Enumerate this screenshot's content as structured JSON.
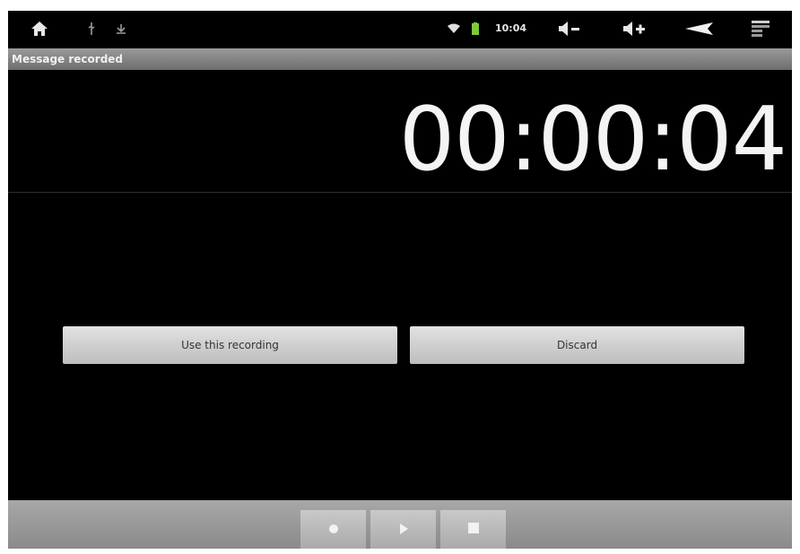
{
  "status_bar": {
    "clock": "10:04",
    "icons": [
      "home-icon",
      "usb-icon",
      "download-icon",
      "wifi-icon",
      "battery-icon",
      "volume-down-icon",
      "volume-up-icon",
      "back-icon",
      "menu-icon"
    ]
  },
  "title_bar": {
    "title": "Message recorded"
  },
  "recorder": {
    "elapsed_time": "00:00:04"
  },
  "actions": {
    "use_label": "Use this recording",
    "discard_label": "Discard"
  },
  "controls": {
    "icons": [
      "record-icon",
      "play-icon",
      "stop-icon"
    ]
  },
  "colors": {
    "background": "#000000",
    "title_bar": "#7f7f7f",
    "button": "#d0d0d0",
    "bottom_bar": "#9a9a9a",
    "battery": "#7ec83c"
  }
}
